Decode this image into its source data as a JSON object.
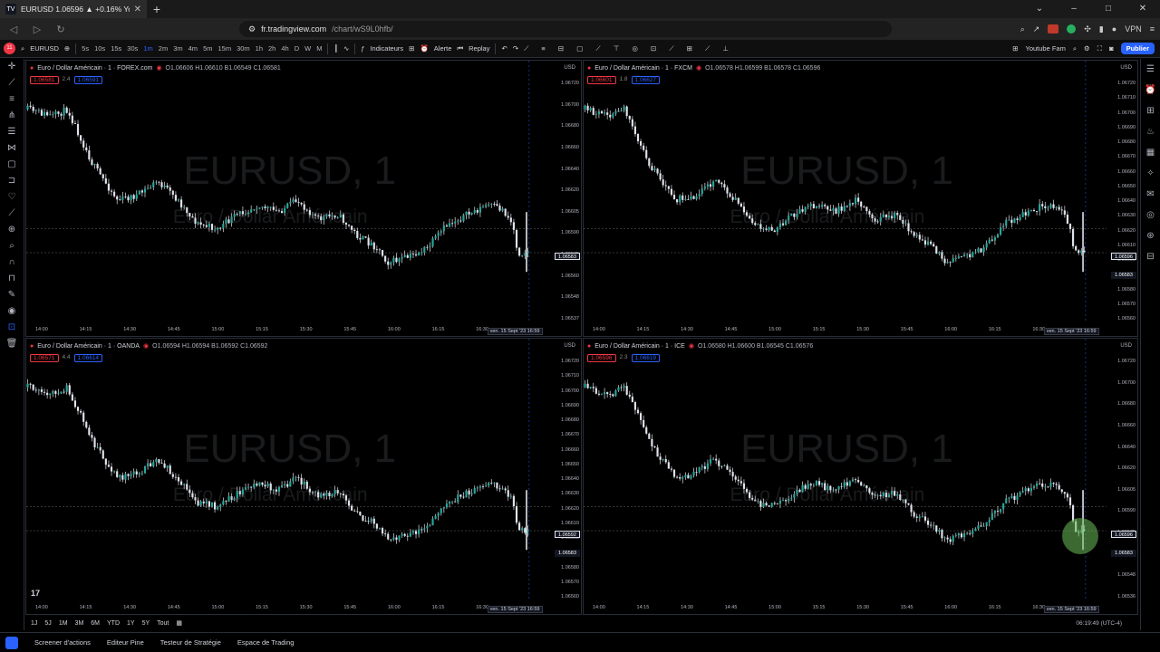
{
  "browser": {
    "tab_title": "EURUSD 1.06596 ▲ +0.16% Youtube Fam",
    "tab_fav": "TV",
    "new_tab": "+",
    "url_host": "fr.tradingview.com",
    "url_path": "/chart/wS9L0hfb/",
    "vpn": "VPN",
    "win_min": "–",
    "win_max": "□",
    "win_close": "✕"
  },
  "toolbar": {
    "symbol": "EURUSD",
    "logo_badge": "11",
    "timeframes": [
      "5s",
      "10s",
      "15s",
      "30s",
      "1m",
      "2m",
      "3m",
      "4m",
      "5m",
      "15m",
      "30m",
      "1h",
      "2h",
      "4h",
      "D",
      "W",
      "M"
    ],
    "active_tf": "1m",
    "indicators": "Indicateurs",
    "alert": "Alerte",
    "replay": "Replay",
    "layout_name": "Youtube Fam",
    "publish": "Publier"
  },
  "panes": [
    {
      "id": "tl",
      "title": "Euro / Dollar Américain · 1 · FOREX.com",
      "ohlc": "O1.06606 H1.06610 B1.06549 C1.06581",
      "chip_sell": "1.06581",
      "spread": "2.4",
      "chip_buy": "1.06591",
      "prices": [
        "1.06720",
        "1.06700",
        "1.06680",
        "1.06660",
        "1.06640",
        "1.06620",
        "1.06605",
        "1.06590",
        "1.06575",
        "1.06560",
        "1.06548",
        "1.06537"
      ],
      "lvl_price": "1.06583",
      "times": [
        "14:00",
        "14:15",
        "14:30",
        "14:45",
        "15:00",
        "15:15",
        "15:30",
        "15:45",
        "16:00",
        "16:15",
        "16:30"
      ],
      "date_label": "ven. 15 Sept '23   16:59"
    },
    {
      "id": "tr",
      "title": "Euro / Dollar Américain · 1 · FXCM",
      "ohlc": "O1.06578 H1.06599 B1.06578 C1.06596",
      "chip_sell": "1.06601",
      "spread": "1.8",
      "chip_buy": "1.06627",
      "prices": [
        "1.06720",
        "1.06710",
        "1.06700",
        "1.06690",
        "1.06680",
        "1.06670",
        "1.06660",
        "1.06650",
        "1.06640",
        "1.06630",
        "1.06620",
        "1.06610",
        "1.06600",
        "1.06590",
        "1.06580",
        "1.06570",
        "1.06560"
      ],
      "lvl_price": "1.06596",
      "lvl_price2": "1.06583",
      "times": [
        "14:00",
        "14:15",
        "14:30",
        "14:45",
        "15:00",
        "15:15",
        "15:30",
        "15:45",
        "16:00",
        "16:15",
        "16:30"
      ],
      "date_label": "ven. 15 Sept '23   16:59"
    },
    {
      "id": "bl",
      "title": "Euro / Dollar Américain · 1 · OANDA",
      "ohlc": "O1.06594 H1.06594 B1.06592 C1.06592",
      "chip_sell": "1.06571",
      "spread": "4.4",
      "chip_buy": "1.06614",
      "prices": [
        "1.06720",
        "1.06710",
        "1.06700",
        "1.06690",
        "1.06680",
        "1.06670",
        "1.06660",
        "1.06650",
        "1.06640",
        "1.06630",
        "1.06620",
        "1.06610",
        "1.06600",
        "1.06590",
        "1.06580",
        "1.06570",
        "1.06560"
      ],
      "lvl_price": "1.06592",
      "lvl_price2": "1.06583",
      "times": [
        "14:00",
        "14:15",
        "14:30",
        "14:45",
        "15:00",
        "15:15",
        "15:30",
        "15:45",
        "16:00",
        "16:15",
        "16:30"
      ],
      "date_label": "ven. 15 Sept '23   16:59"
    },
    {
      "id": "br",
      "title": "Euro / Dollar Américain · 1 · ICE",
      "ohlc": "O1.06580 H1.06600 B1.06545 C1.06576",
      "chip_sell": "1.06596",
      "spread": "2.3",
      "chip_buy": "1.06619",
      "prices": [
        "1.06720",
        "1.06700",
        "1.06680",
        "1.06660",
        "1.06640",
        "1.06620",
        "1.06605",
        "1.06590",
        "1.06575",
        "1.06560",
        "1.06548",
        "1.06536"
      ],
      "lvl_price": "1.06596",
      "lvl_price2": "1.06583",
      "times": [
        "14:00",
        "14:15",
        "14:30",
        "14:45",
        "15:00",
        "15:15",
        "15:30",
        "15:45",
        "16:00",
        "16:15",
        "16:30"
      ],
      "date_label": "ven. 15 Sept '23   16:59"
    }
  ],
  "watermark": {
    "symbol": "EURUSD, 1",
    "name": "Euro / Dollar Américain"
  },
  "range_bar": {
    "ranges": [
      "1J",
      "5J",
      "1M",
      "3M",
      "6M",
      "YTD",
      "1Y",
      "5Y",
      "Tout"
    ],
    "clock": "06:19:49 (UTC-4)"
  },
  "footer": {
    "items": [
      "Screener d'actions",
      "Editeur Pine",
      "Testeur de Stratégie",
      "Espace de Trading"
    ]
  },
  "colors": {
    "up": "#26a69a",
    "down": "#ef5350",
    "accent": "#2962ff",
    "candle_line": "#e0e3eb"
  },
  "tv_logo": "17"
}
